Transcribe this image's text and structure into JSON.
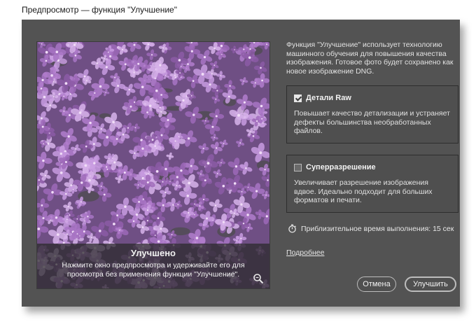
{
  "window": {
    "title": "Предпросмотр — функция \"Улучшение\""
  },
  "intro_text": "Функция \"Улучшение\" использует технологию машинного обучения для повышения качества изображения. Готовое фото будет сохранено как новое изображение DNG.",
  "preview": {
    "caption_title": "Улучшено",
    "caption_text": "Нажмите окно предпросмотра и удерживайте его для просмотра без применения функции \"Улучшение\".",
    "zoom_icon": "magnifier-icon"
  },
  "options": [
    {
      "label": "Детали Raw",
      "checked": true,
      "description": "Повышает качество детализации и устраняет дефекты большинства необработанных файлов."
    },
    {
      "label": "Суперразрешение",
      "checked": false,
      "description": "Увеличивает разрешение изображения вдвое. Идеально подходит для больших форматов и печати."
    }
  ],
  "estimate": {
    "icon": "stopwatch-icon",
    "text": "Приблизительное время выполнения: 15 сек"
  },
  "learn_more": "Подробнее",
  "buttons": {
    "cancel": "Отмена",
    "enhance": "Улучшить"
  },
  "colors": {
    "dialog_bg": "#535353",
    "accent_flowers": "#b47fcf"
  }
}
